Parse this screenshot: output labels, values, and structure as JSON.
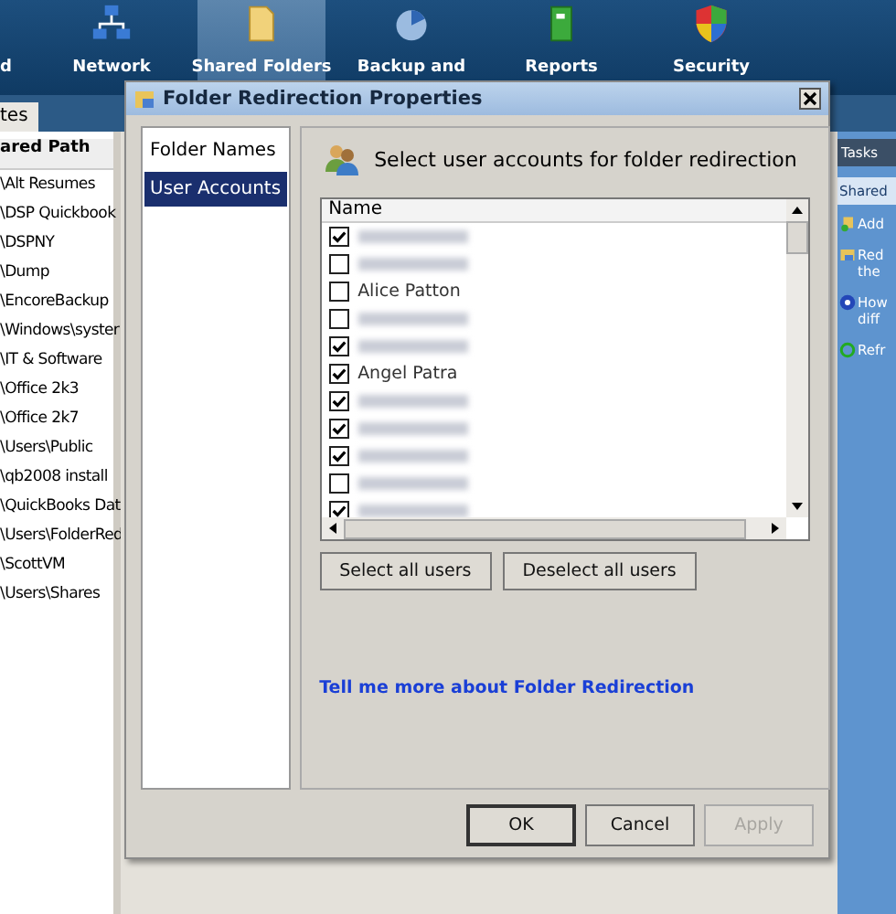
{
  "nav": [
    {
      "label": "d",
      "selected": false
    },
    {
      "label": "Network",
      "selected": false
    },
    {
      "label": "Shared Folders",
      "selected": true
    },
    {
      "label": "Backup and",
      "selected": false
    },
    {
      "label": "Reports",
      "selected": false
    },
    {
      "label": "Security",
      "selected": false
    }
  ],
  "back_tab": "tes",
  "back_list": {
    "header": "ared Path",
    "rows": [
      "\\Alt Resumes",
      "\\DSP Quickbook",
      "\\DSPNY",
      "\\Dump",
      "\\EncoreBackup",
      "\\Windows\\syster",
      "\\IT & Software",
      "\\Office 2k3",
      "\\Office 2k7",
      "\\Users\\Public",
      "\\qb2008 install",
      "\\QuickBooks Dat",
      "\\Users\\FolderRed",
      "\\ScottVM",
      "\\Users\\Shares"
    ]
  },
  "tasks": {
    "title": "Tasks",
    "tab": "Shared",
    "items": [
      {
        "lines": [
          "Add"
        ]
      },
      {
        "lines": [
          "Red",
          "the"
        ]
      },
      {
        "lines": [
          "How",
          "diff"
        ]
      },
      {
        "lines": [
          "Refr"
        ]
      }
    ]
  },
  "dialog": {
    "title": "Folder Redirection Properties",
    "nav": [
      {
        "label": "Folder Names",
        "selected": false
      },
      {
        "label": "User Accounts",
        "selected": true
      }
    ],
    "heading": "Select user accounts for folder redirection",
    "column": "Name",
    "users": [
      {
        "kind": "redacted",
        "checked": true
      },
      {
        "kind": "redacted",
        "checked": false
      },
      {
        "kind": "name",
        "name": "Alice Patton",
        "checked": false
      },
      {
        "kind": "redacted",
        "checked": false
      },
      {
        "kind": "redacted",
        "checked": true
      },
      {
        "kind": "name",
        "name": "Angel Patra",
        "checked": true
      },
      {
        "kind": "redacted",
        "checked": true
      },
      {
        "kind": "redacted",
        "checked": true
      },
      {
        "kind": "redacted",
        "checked": true
      },
      {
        "kind": "redacted",
        "checked": false
      },
      {
        "kind": "redacted",
        "checked": true
      }
    ],
    "list_buttons": [
      "Select all users",
      "Deselect all users"
    ],
    "link": "Tell me more about Folder Redirection",
    "buttons": [
      {
        "label": "OK",
        "disabled": false
      },
      {
        "label": "Cancel",
        "disabled": false
      },
      {
        "label": "Apply",
        "disabled": true
      }
    ]
  }
}
